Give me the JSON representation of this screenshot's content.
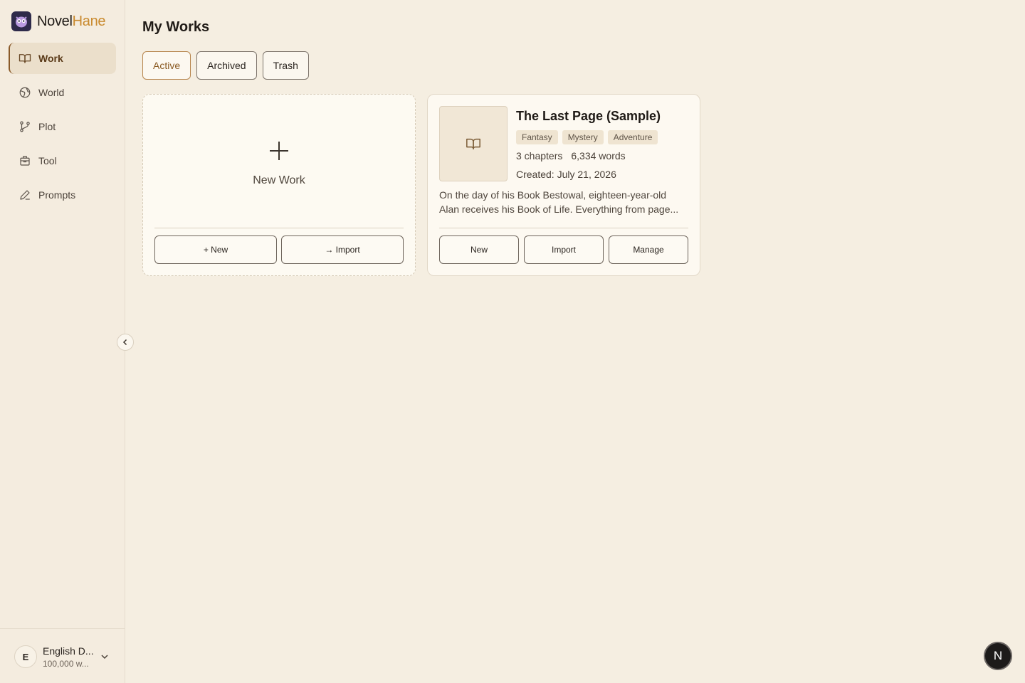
{
  "brand": {
    "name_part1": "Novel",
    "name_part2": "Hane"
  },
  "sidebar": {
    "items": [
      {
        "label": "Work",
        "icon": "book-icon",
        "active": true
      },
      {
        "label": "World",
        "icon": "globe-icon"
      },
      {
        "label": "Plot",
        "icon": "branch-icon"
      },
      {
        "label": "Tool",
        "icon": "toolbox-icon"
      },
      {
        "label": "Prompts",
        "icon": "pen-icon"
      }
    ],
    "account": {
      "initial": "E",
      "name": "English D...",
      "subtitle": "100,000 w..."
    }
  },
  "main": {
    "title": "My Works",
    "tabs": [
      {
        "label": "Active",
        "active": true
      },
      {
        "label": "Archived"
      },
      {
        "label": "Trash"
      }
    ],
    "new_card": {
      "label": "New Work",
      "new_button": "+ New",
      "import_button": "→ Import"
    },
    "work": {
      "title": "The Last Page (Sample)",
      "tags": [
        "Fantasy",
        "Mystery",
        "Adventure"
      ],
      "chapters": "3 chapters",
      "words": "6,334 words",
      "created": "Created: July 21, 2026",
      "description": "On the day of his Book Bestowal, eighteen-year-old Alan receives his Book of Life. Everything from page...",
      "buttons": {
        "new": "New",
        "import": "Import",
        "manage": "Manage"
      }
    }
  },
  "fab": {
    "label": "N"
  },
  "colors": {
    "accent": "#c98a2e",
    "background": "#f5eee1",
    "active_tab": "#8a5a22"
  }
}
